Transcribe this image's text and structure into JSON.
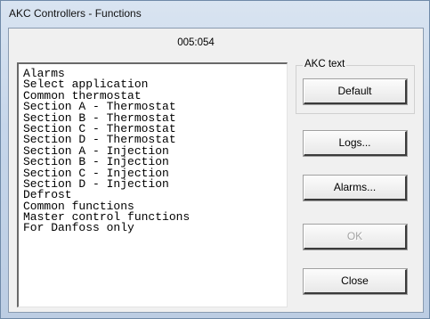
{
  "window": {
    "title": "AKC Controllers - Functions"
  },
  "code_label": "005:054",
  "list": {
    "items": [
      "Alarms",
      "Select application",
      "Common thermostat",
      "Section A - Thermostat",
      "Section B - Thermostat",
      "Section C - Thermostat",
      "Section D - Thermostat",
      "Section A - Injection",
      "Section B - Injection",
      "Section C - Injection",
      "Section D - Injection",
      "Defrost",
      "Common functions",
      "Master control functions",
      "For Danfoss only"
    ]
  },
  "akc_text": {
    "legend": "AKC text",
    "default_label": "Default"
  },
  "buttons": {
    "logs_label": "Logs...",
    "alarms_label": "Alarms...",
    "ok_label": "OK",
    "close_label": "Close"
  }
}
